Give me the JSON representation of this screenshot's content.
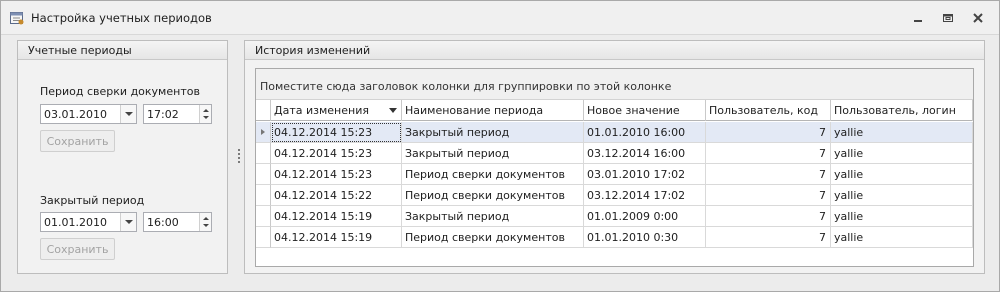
{
  "window": {
    "title": "Настройка учетных периодов"
  },
  "left_panel": {
    "header": "Учетные периоды",
    "reconcile": {
      "label": "Период сверки документов",
      "date": "03.01.2010",
      "time": "17:02",
      "save_label": "Сохранить"
    },
    "closed": {
      "label": "Закрытый период",
      "date": "01.01.2010",
      "time": "16:00",
      "save_label": "Сохранить"
    }
  },
  "history_panel": {
    "header": "История изменений",
    "group_hint": "Поместите сюда заголовок колонки для группировки по этой колонке",
    "columns": [
      "Дата изменения",
      "Наименование периода",
      "Новое значение",
      "Пользователь, код",
      "Пользователь, логин"
    ],
    "rows": [
      [
        "04.12.2014 15:23",
        "Закрытый период",
        "01.01.2010 16:00",
        "7",
        "yallie"
      ],
      [
        "04.12.2014 15:23",
        "Закрытый период",
        "03.12.2014 16:00",
        "7",
        "yallie"
      ],
      [
        "04.12.2014 15:23",
        "Период сверки документов",
        "03.01.2010 17:02",
        "7",
        "yallie"
      ],
      [
        "04.12.2014 15:22",
        "Период сверки документов",
        "03.12.2014 17:02",
        "7",
        "yallie"
      ],
      [
        "04.12.2014 15:19",
        "Закрытый период",
        "01.01.2009 0:00",
        "7",
        "yallie"
      ],
      [
        "04.12.2014 15:19",
        "Период сверки документов",
        "01.01.2010 0:30",
        "7",
        "yallie"
      ]
    ]
  },
  "icons": {
    "app": "calendar-settings-icon",
    "minimize": "minimize-icon",
    "restore": "restore-icon",
    "close": "close-icon"
  }
}
